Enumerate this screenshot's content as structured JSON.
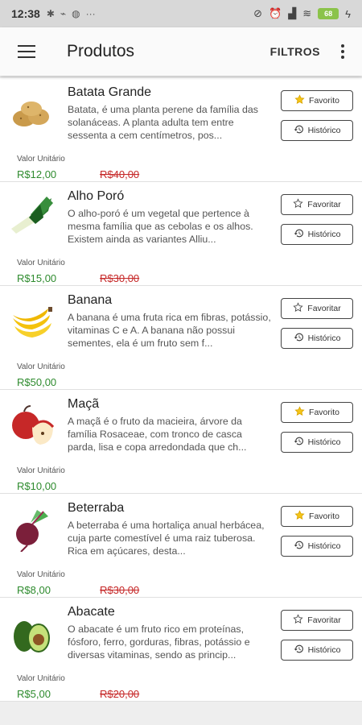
{
  "status_bar": {
    "time": "12:38",
    "battery": "68"
  },
  "app_bar": {
    "title": "Produtos",
    "filters_label": "FILTROS"
  },
  "unit_label": "Valor Unitário",
  "history_label": "Histórico",
  "products": [
    {
      "name": "Batata Grande",
      "description": "Batata, é uma planta perene da família das solanáceas. A planta adulta tem entre sessenta a cem centímetros, pos...",
      "price": "R$12,00",
      "old_price": "R$40,00",
      "favorite": true,
      "favorite_label": "Favorito",
      "icon": "potato-icon"
    },
    {
      "name": "Alho Poró",
      "description": "O alho-poró é um vegetal que pertence à mesma família que as cebolas e os alhos. Existem ainda as variantes Alliu...",
      "price": "R$15,00",
      "old_price": "R$30,00",
      "favorite": false,
      "favorite_label": "Favoritar",
      "icon": "leek-icon"
    },
    {
      "name": "Banana",
      "description": "A banana é uma fruta rica em fibras, potássio, vitaminas C e A. A banana não possui sementes, ela é um fruto sem f...",
      "price": "R$50,00",
      "old_price": "",
      "favorite": false,
      "favorite_label": "Favoritar",
      "icon": "banana-icon"
    },
    {
      "name": "Maçã",
      "description": "A maçã é o fruto da macieira, árvore da família Rosaceae, com tronco de casca parda, lisa e copa arredondada que ch...",
      "price": "R$10,00",
      "old_price": "",
      "favorite": true,
      "favorite_label": "Favorito",
      "icon": "apple-icon"
    },
    {
      "name": "Beterraba",
      "description": "A beterraba é uma hortaliça anual herbácea, cuja parte comestível é uma raiz tuberosa. Rica em açúcares, desta...",
      "price": "R$8,00",
      "old_price": "R$30,00",
      "favorite": true,
      "favorite_label": "Favorito",
      "icon": "beet-icon"
    },
    {
      "name": "Abacate",
      "description": "O abacate é um fruto rico em proteínas, fósforo, ferro, gorduras, fibras, potássio e diversas vitaminas, sendo as princip...",
      "price": "R$5,00",
      "old_price": "R$20,00",
      "favorite": false,
      "favorite_label": "Favoritar",
      "icon": "avocado-icon"
    }
  ],
  "colors": {
    "price_green": "#2e8b2e",
    "old_price_red": "#c62828",
    "star_filled": "#f5c518"
  }
}
